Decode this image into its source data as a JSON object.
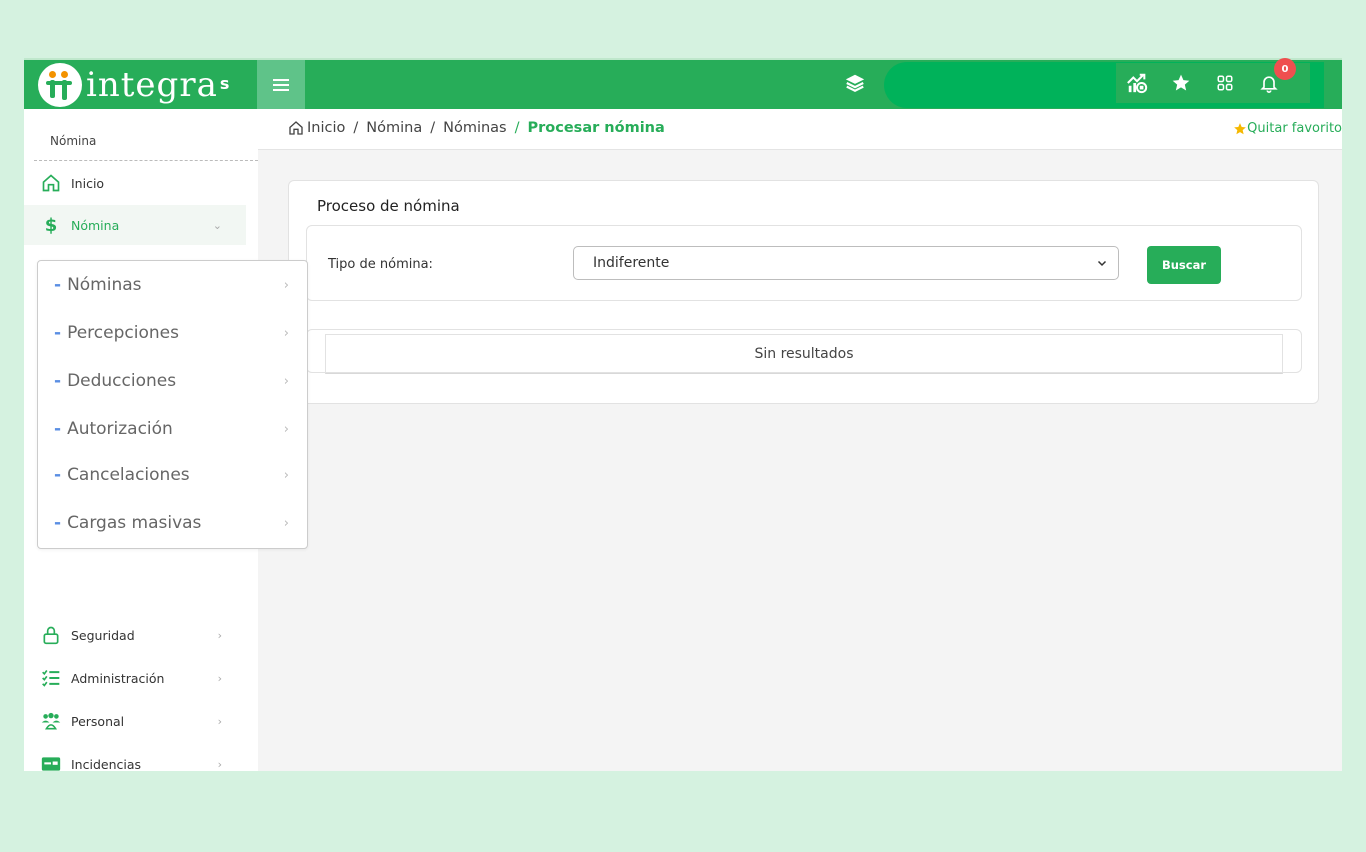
{
  "brand": {
    "name": "integra",
    "suffix": "s"
  },
  "topbar": {
    "icons": [
      "menu-icon",
      "layers-icon",
      "dashboard-icon",
      "star-icon",
      "apps-grid-icon",
      "bell-icon"
    ],
    "notifications_count": "0"
  },
  "sidebar": {
    "title": "Nómina",
    "items": [
      {
        "label": "Inicio",
        "icon": "home-icon"
      },
      {
        "label": "Nómina",
        "icon": "dollar-icon"
      },
      {
        "label": "Seguridad",
        "icon": "lock-icon"
      },
      {
        "label": "Administración",
        "icon": "checklist-icon"
      },
      {
        "label": "Personal",
        "icon": "people-icon"
      },
      {
        "label": "Incidencias",
        "icon": "id-card-icon"
      }
    ]
  },
  "submenu": {
    "items": [
      {
        "label": "Nóminas"
      },
      {
        "label": "Percepciones"
      },
      {
        "label": "Deducciones"
      },
      {
        "label": "Autorización"
      },
      {
        "label": "Cancelaciones"
      },
      {
        "label": "Cargas masivas"
      }
    ]
  },
  "breadcrumb": {
    "items": [
      "Inicio",
      "Nómina",
      "Nóminas"
    ],
    "current": "Procesar nómina",
    "favorite_label": "Quitar favorito"
  },
  "main": {
    "card_title": "Proceso de nómina",
    "filter_label": "Tipo de nómina:",
    "select_value": "Indiferente",
    "search_button": "Buscar",
    "empty_message": "Sin resultados"
  },
  "colors": {
    "brand_green": "#27ad59",
    "page_background": "#d5f2e0",
    "badge_red": "#ef4f4f",
    "submenu_dash": "#5a8ee3"
  }
}
